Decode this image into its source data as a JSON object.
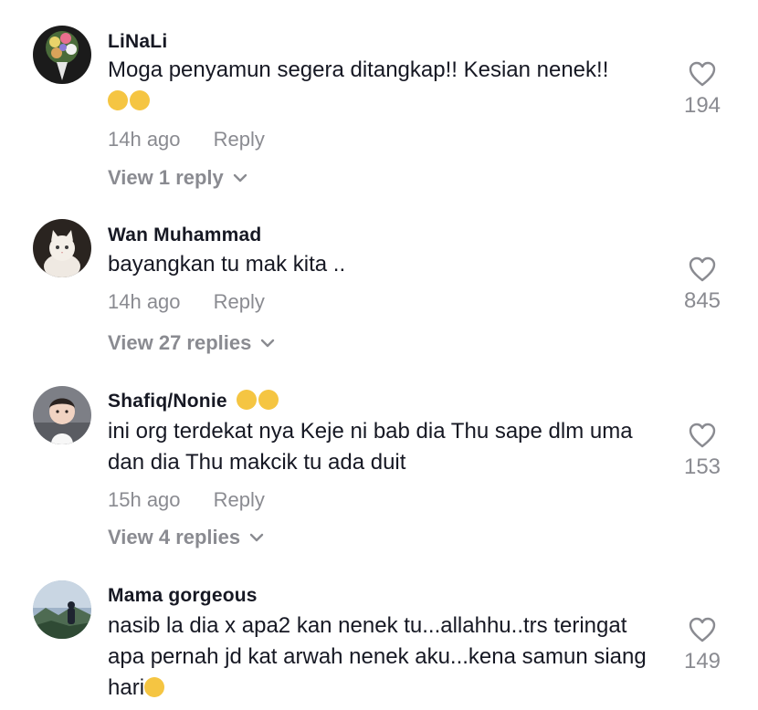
{
  "comments": [
    {
      "username": "LiNaLi",
      "text": "Moga penyamun segera ditangkap!! Kesian nenek!!",
      "emoji_suffix": "😔😔",
      "time": "14h ago",
      "reply_label": "Reply",
      "view_replies": "View 1 reply",
      "likes": "194",
      "avatar_icon": "flower-bouquet-avatar"
    },
    {
      "username": "Wan Muhammad",
      "text": "bayangkan tu mak kita ..",
      "time": "14h ago",
      "reply_label": "Reply",
      "view_replies": "View 27 replies",
      "likes": "845",
      "avatar_icon": "white-cat-avatar"
    },
    {
      "username": "Shafiq/Nonie",
      "username_emoji": "😝😝",
      "text": "ini org terdekat nya Keje ni bab dia Thu sape dlm uma dan dia Thu makcik tu ada duit",
      "time": "15h ago",
      "reply_label": "Reply",
      "view_replies": "View 4 replies",
      "likes": "153",
      "avatar_icon": "child-photo-avatar"
    },
    {
      "username": "Mama gorgeous",
      "text": "nasib la dia x apa2 kan nenek tu...allahhu..trs teringat apa pernah jd kat arwah nenek aku...kena samun siang hari",
      "emoji_suffix": "😭",
      "likes": "149",
      "avatar_icon": "landscape-silhouette-avatar"
    }
  ],
  "colors": {
    "primary_text": "#161823",
    "secondary_text": "#8a8b91",
    "background": "#ffffff"
  }
}
